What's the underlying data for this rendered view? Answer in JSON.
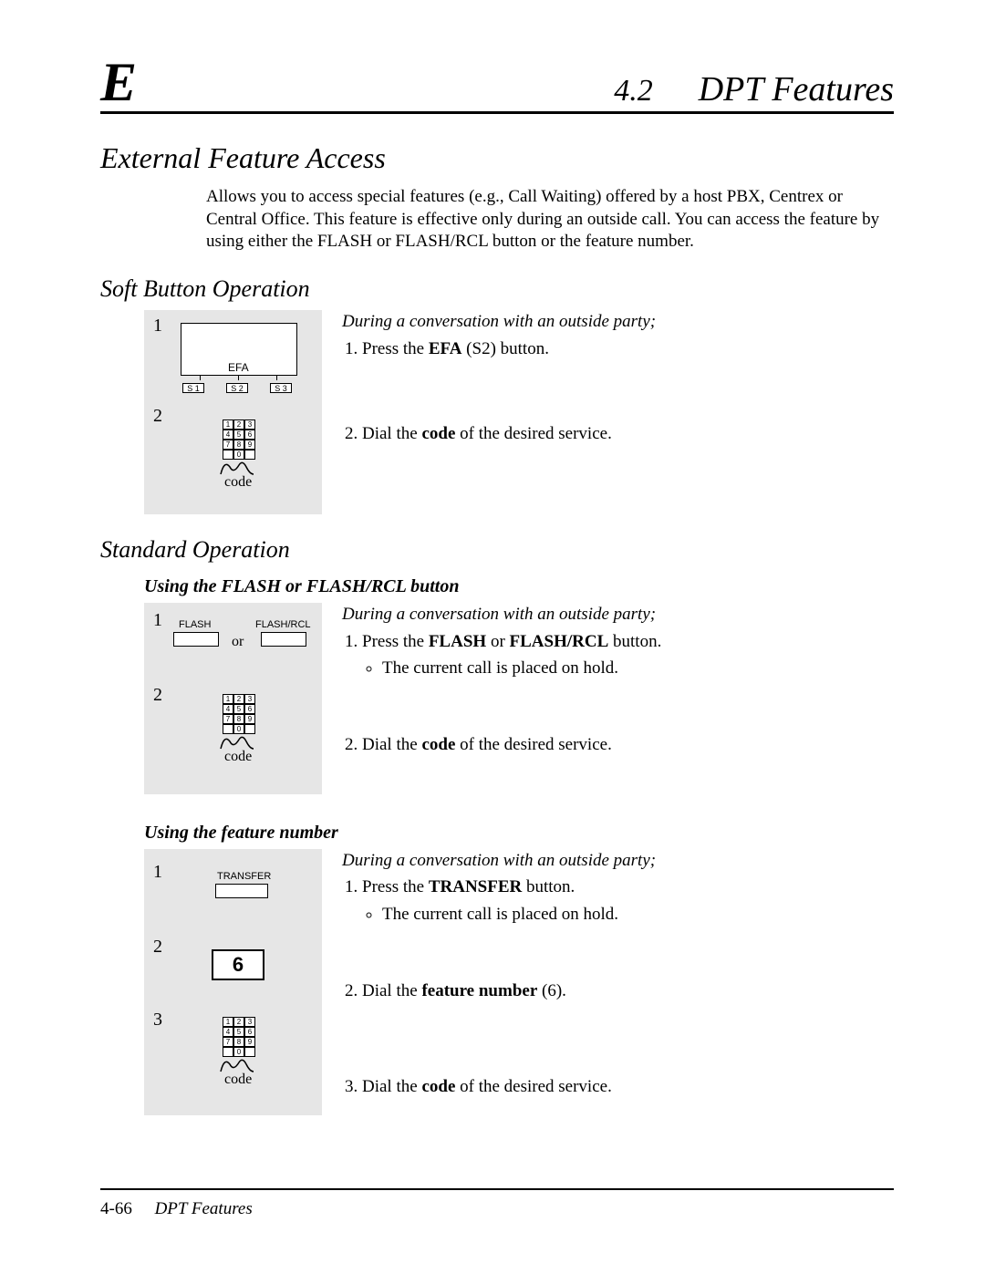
{
  "header": {
    "letter": "E",
    "section_num": "4.2",
    "section_title": "DPT Features"
  },
  "main_title": "External Feature Access",
  "intro": "Allows you to access special features (e.g., Call Waiting) offered by a host PBX, Centrex or Central Office. This feature is effective only during an outside call. You can access the feature by using either the FLASH or FLASH/RCL button or the feature number.",
  "sections": {
    "soft": {
      "title": "Soft Button Operation",
      "lead": "During a conversation with an outside party;",
      "steps": [
        {
          "pre": "Press the ",
          "bold": "EFA",
          "mid": " (S2) button.",
          "post": ""
        },
        {
          "pre": "Dial the ",
          "bold": "code",
          "mid": " of the desired service.",
          "post": ""
        }
      ],
      "diagram": {
        "s1": "1",
        "s2": "2",
        "efa": "EFA",
        "btnS1": "S 1",
        "btnS2": "S 2",
        "btnS3": "S 3",
        "code": "code"
      }
    },
    "standard": {
      "title": "Standard Operation",
      "flash": {
        "subtitle": "Using the FLASH or FLASH/RCL button",
        "lead": "During a conversation with an outside party;",
        "step1_pre": "Press the ",
        "step1_b1": "FLASH",
        "step1_mid": " or ",
        "step1_b2": "FLASH/RCL",
        "step1_post": " button.",
        "bullet1": "The current call is placed on hold.",
        "step2_pre": "Dial the ",
        "step2_bold": "code",
        "step2_post": " of the desired service.",
        "diagram": {
          "s1": "1",
          "s2": "2",
          "flash": "FLASH",
          "flashrcl": "FLASH/RCL",
          "or": "or",
          "code": "code"
        }
      },
      "fn": {
        "subtitle": "Using the feature number",
        "lead": "During a conversation with an outside party;",
        "step1_pre": "Press the ",
        "step1_bold": "TRANSFER",
        "step1_post": " button.",
        "bullet1": "The current call is placed on hold.",
        "step2_pre": "Dial the ",
        "step2_bold": "feature number",
        "step2_post": " (6).",
        "step3_pre": "Dial the ",
        "step3_bold": "code",
        "step3_post": " of the desired service.",
        "diagram": {
          "s1": "1",
          "s2": "2",
          "s3": "3",
          "transfer": "TRANSFER",
          "digit": "6",
          "code": "code"
        }
      }
    }
  },
  "footer": {
    "page": "4-66",
    "title": "DPT Features"
  },
  "keypad": {
    "rows": [
      [
        "1",
        "2",
        "3"
      ],
      [
        "4",
        "5",
        "6"
      ],
      [
        "7",
        "8",
        "9"
      ],
      [
        "",
        "0",
        ""
      ]
    ]
  }
}
